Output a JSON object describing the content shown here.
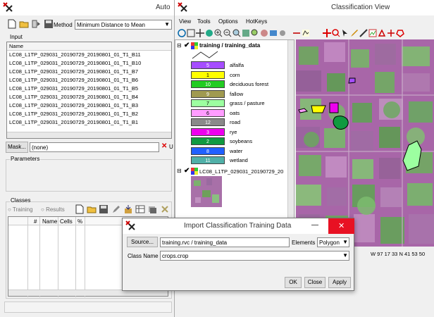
{
  "auto_window": {
    "title": "Auto",
    "method_label": "Method",
    "method_value": "Minimum Distance to Mean",
    "input_label": "Input",
    "name_header": "Name",
    "input_files": [
      "LC08_L1TP_029031_20190729_20190801_01_T1_B11",
      "LC08_L1TP_029031_20190729_20190801_01_T1_B10",
      "LC08_L1TP_029031_20190729_20190801_01_T1_B7",
      "LC08_L1TP_029031_20190729_20190801_01_T1_B6",
      "LC08_L1TP_029031_20190729_20190801_01_T1_B5",
      "LC08_L1TP_029031_20190729_20190801_01_T1_B4",
      "LC08_L1TP_029031_20190729_20190801_01_T1_B3",
      "LC08_L1TP_029031_20190729_20190801_01_T1_B2",
      "LC08_L1TP_029031_20190729_20190801_01_T1_B1"
    ],
    "mask_button": "Mask...",
    "mask_value": "(none)",
    "mask_clear": "U",
    "parameters_label": "Parameters",
    "classes_label": "Classes",
    "training_label": "Training",
    "results_label": "Results",
    "columns": [
      "#",
      "Name",
      "Cells",
      "%"
    ]
  },
  "classification_view": {
    "title": "Classification View",
    "menu": [
      "View",
      "Tools",
      "Options",
      "HotKeys"
    ],
    "layer_title": "training / training_data",
    "classes": [
      {
        "num": "5",
        "name": "alfalfa",
        "color": "#a64dff"
      },
      {
        "num": "1",
        "name": "corn",
        "color": "#ffff00"
      },
      {
        "num": "10",
        "name": "deciduous forest",
        "color": "#22cc22"
      },
      {
        "num": "9",
        "name": "fallow",
        "color": "#a09a50"
      },
      {
        "num": "7",
        "name": "grass / pasture",
        "color": "#9cffa0"
      },
      {
        "num": "6",
        "name": "oats",
        "color": "#ff9cff"
      },
      {
        "num": "12",
        "name": "road",
        "color": "#8a8a8a"
      },
      {
        "num": "3",
        "name": "rye",
        "color": "#ee00ee"
      },
      {
        "num": "2",
        "name": "soybeans",
        "color": "#109a40"
      },
      {
        "num": "8",
        "name": "water",
        "color": "#2060ff"
      },
      {
        "num": "11",
        "name": "wetland",
        "color": "#50b0a8"
      }
    ],
    "raster_layer": "LC08_L1TP_029031_20190729_20",
    "coords": "W 97 17 33  N 41 53 50"
  },
  "import_dialog": {
    "title": "Import Classification Training Data",
    "source_button": "Source...",
    "source_value": "training.rvc / training_data",
    "elements_label": "Elements",
    "elements_value": "Polygon",
    "classname_label": "Class Name",
    "classname_value": "crops.crop",
    "ok": "OK",
    "close": "Close",
    "apply": "Apply"
  },
  "colors": {
    "accent": "#0078d7",
    "close_red": "#e81123",
    "map_magenta": "#b06ab0",
    "map_green": "#5aa05a"
  }
}
